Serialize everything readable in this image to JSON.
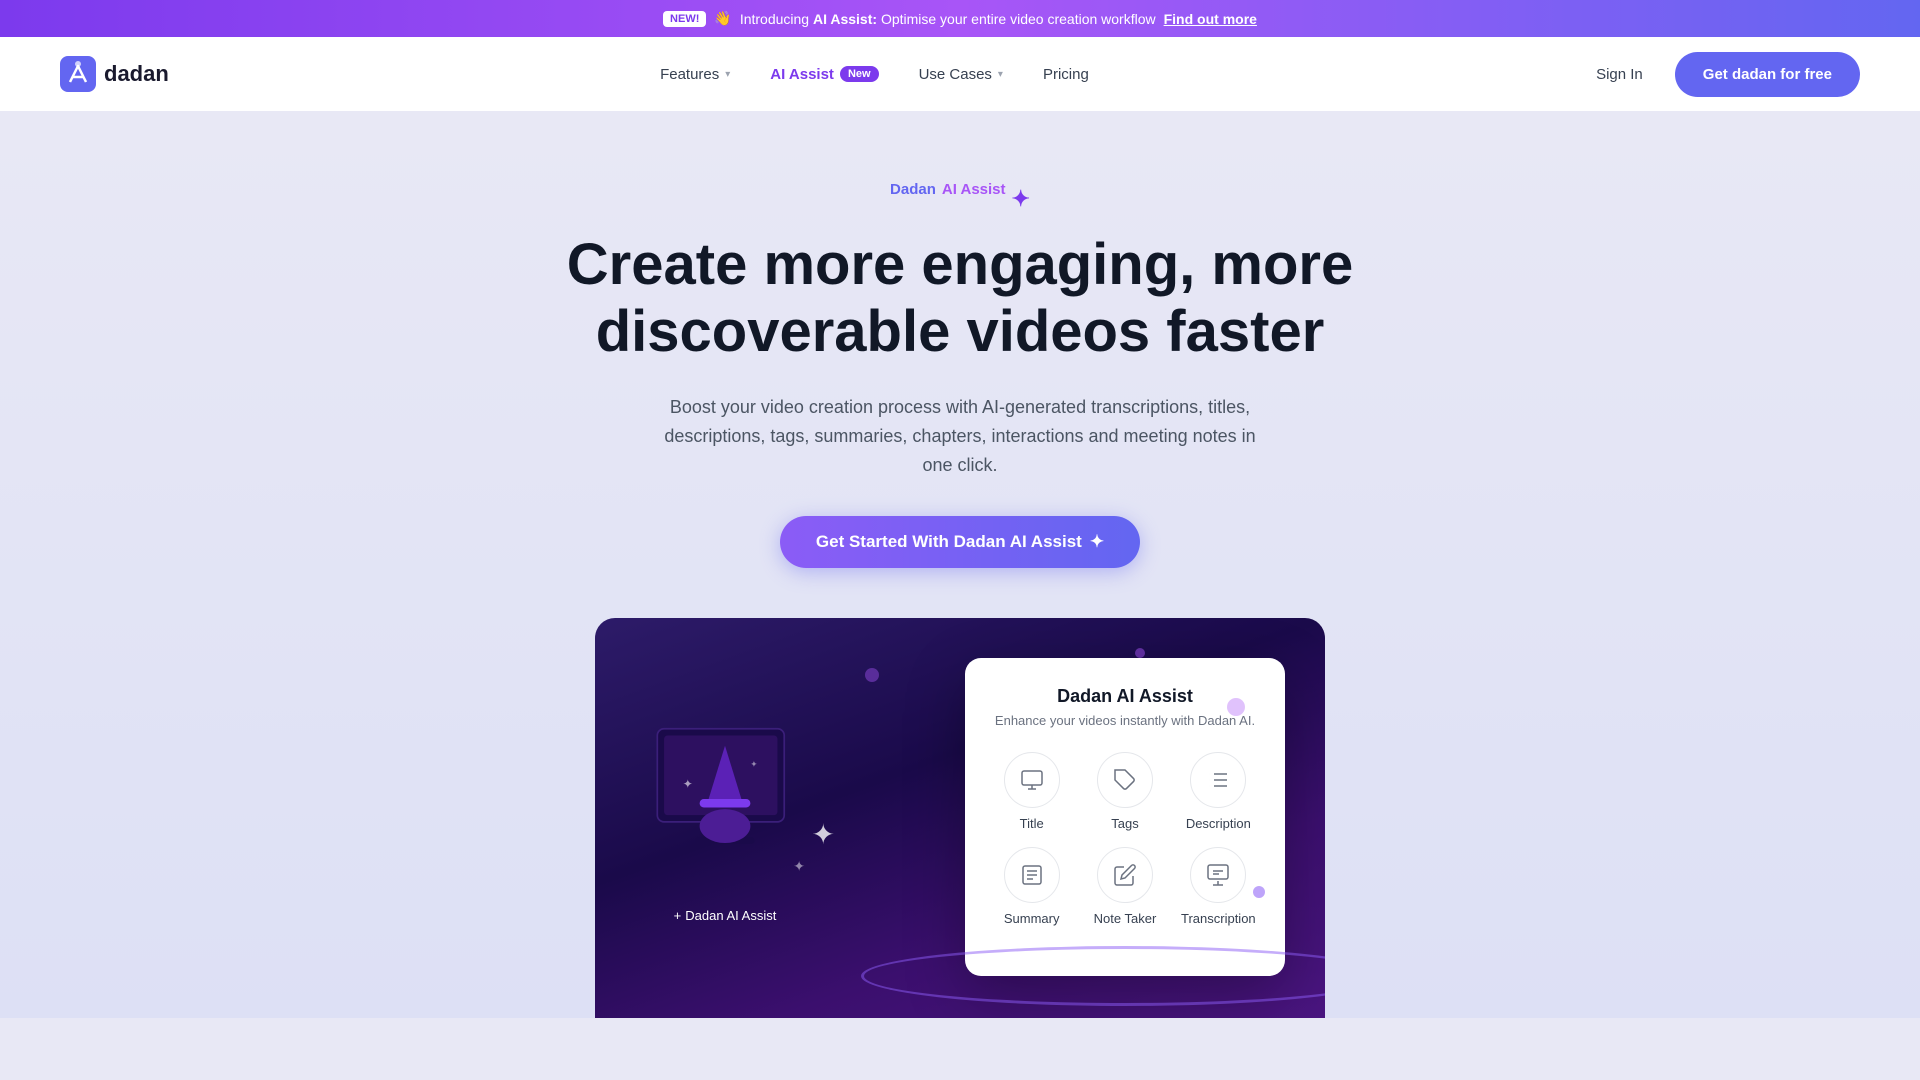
{
  "announcement": {
    "new_badge": "NEW!",
    "emoji": "👋",
    "text": "Introducing ",
    "brand": "AI Assist:",
    "description": " Optimise your entire video creation workflow",
    "cta": "Find out more"
  },
  "nav": {
    "logo_text": "dadan",
    "links": [
      {
        "label": "Features",
        "has_dropdown": true
      },
      {
        "label": "AI Assist",
        "tag": "New",
        "is_ai": true
      },
      {
        "label": "Use Cases",
        "has_dropdown": true
      },
      {
        "label": "Pricing",
        "has_dropdown": false
      }
    ],
    "sign_in": "Sign In",
    "get_free": "Get dadan for free"
  },
  "hero": {
    "subtitle_dadan": "Dadan",
    "subtitle_ai": "AI Assist",
    "sparkle": "✦",
    "title": "Create more engaging, more discoverable videos faster",
    "description": "Boost your video creation process with AI-generated transcriptions, titles, descriptions, tags, summaries, chapters, interactions and meeting notes in one click.",
    "cta_label": "Get Started With Dadan AI Assist",
    "cta_sparkle": "✦"
  },
  "ai_panel": {
    "title": "Dadan AI Assist",
    "subtitle": "Enhance your videos instantly with Dadan AI.",
    "items": [
      {
        "label": "Title",
        "icon": "📹"
      },
      {
        "label": "Tags",
        "icon": "🏷️"
      },
      {
        "label": "Description",
        "icon": "📝"
      },
      {
        "label": "Summary",
        "icon": "📋"
      },
      {
        "label": "Note Taker",
        "icon": "✏️"
      },
      {
        "label": "Transcription",
        "icon": "🎬"
      }
    ]
  },
  "wizard_label_plus": "+",
  "wizard_label_text": "Dadan AI Assist",
  "colors": {
    "primary": "#6366f1",
    "purple": "#7c3aed",
    "gradient_start": "#8b5cf6",
    "gradient_end": "#6366f1"
  }
}
